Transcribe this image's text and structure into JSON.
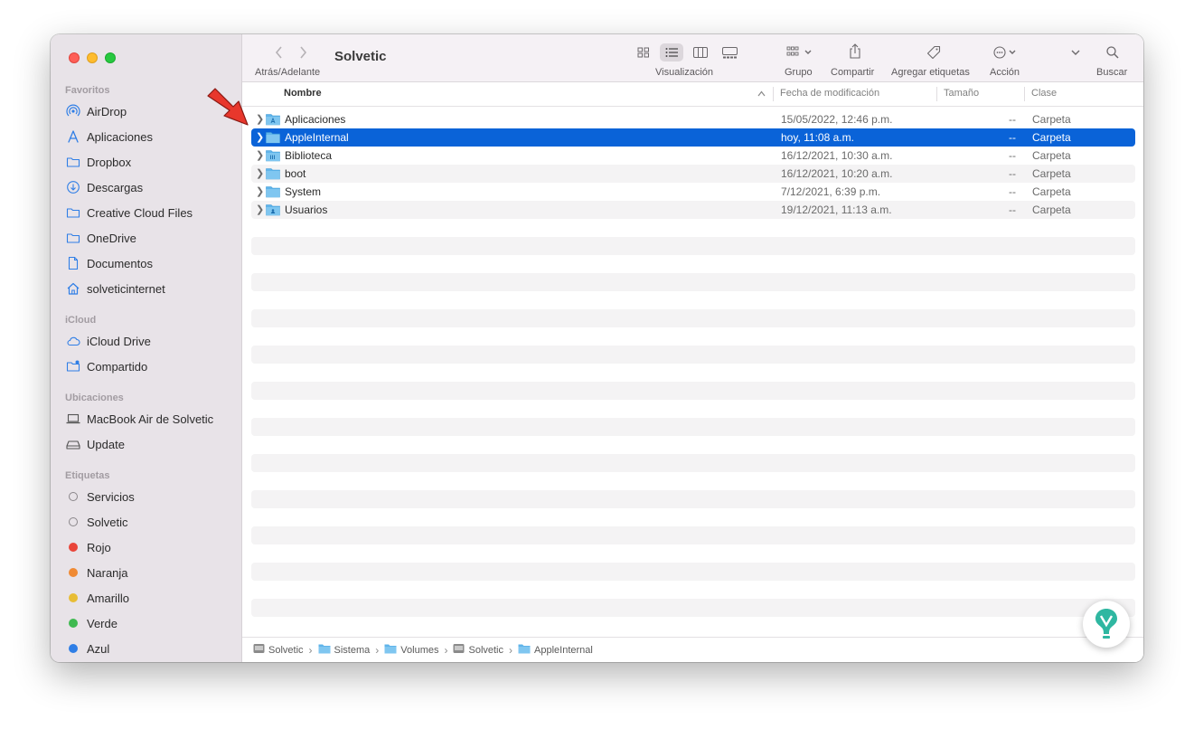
{
  "window": {
    "title": "Solvetic"
  },
  "toolbar": {
    "nav_label": "Atrás/Adelante",
    "view_label": "Visualización",
    "group_label": "Grupo",
    "share_label": "Compartir",
    "tags_label": "Agregar etiquetas",
    "action_label": "Acción",
    "search_label": "Buscar"
  },
  "sidebar": {
    "favorites_title": "Favoritos",
    "favorites": [
      {
        "label": "AirDrop",
        "icon": "airdrop-icon"
      },
      {
        "label": "Aplicaciones",
        "icon": "applications-icon"
      },
      {
        "label": "Dropbox",
        "icon": "folder-icon"
      },
      {
        "label": "Descargas",
        "icon": "download-icon"
      },
      {
        "label": "Creative Cloud Files",
        "icon": "folder-icon"
      },
      {
        "label": "OneDrive",
        "icon": "folder-icon"
      },
      {
        "label": "Documentos",
        "icon": "document-icon"
      },
      {
        "label": "solveticinternet",
        "icon": "home-icon"
      }
    ],
    "icloud_title": "iCloud",
    "icloud": [
      {
        "label": "iCloud Drive",
        "icon": "cloud-icon"
      },
      {
        "label": "Compartido",
        "icon": "shared-folder-icon"
      }
    ],
    "locations_title": "Ubicaciones",
    "locations": [
      {
        "label": "MacBook Air de Solvetic",
        "icon": "laptop-icon"
      },
      {
        "label": "Update",
        "icon": "disk-icon"
      }
    ],
    "tags_title": "Etiquetas",
    "tags": [
      {
        "label": "Servicios",
        "color": ""
      },
      {
        "label": "Solvetic",
        "color": ""
      },
      {
        "label": "Rojo",
        "color": "#e9453a"
      },
      {
        "label": "Naranja",
        "color": "#f08a34"
      },
      {
        "label": "Amarillo",
        "color": "#e8bd35"
      },
      {
        "label": "Verde",
        "color": "#3fb950"
      },
      {
        "label": "Azul",
        "color": "#2f7ee6"
      }
    ]
  },
  "columns": {
    "name": "Nombre",
    "date": "Fecha de modificación",
    "size": "Tamaño",
    "kind": "Clase"
  },
  "files": [
    {
      "name": "Aplicaciones",
      "date": "15/05/2022, 12:46 p.m.",
      "size": "--",
      "kind": "Carpeta",
      "icon": "applications-folder-icon",
      "selected": false
    },
    {
      "name": "AppleInternal",
      "date": "hoy, 11:08 a.m.",
      "size": "--",
      "kind": "Carpeta",
      "icon": "folder-icon",
      "selected": true
    },
    {
      "name": "Biblioteca",
      "date": "16/12/2021, 10:30 a.m.",
      "size": "--",
      "kind": "Carpeta",
      "icon": "library-folder-icon",
      "selected": false
    },
    {
      "name": "boot",
      "date": "16/12/2021, 10:20 a.m.",
      "size": "--",
      "kind": "Carpeta",
      "icon": "folder-icon",
      "selected": false
    },
    {
      "name": "System",
      "date": "7/12/2021, 6:39 p.m.",
      "size": "--",
      "kind": "Carpeta",
      "icon": "system-folder-icon",
      "selected": false
    },
    {
      "name": "Usuarios",
      "date": "19/12/2021, 11:13 a.m.",
      "size": "--",
      "kind": "Carpeta",
      "icon": "users-folder-icon",
      "selected": false
    }
  ],
  "pathbar": [
    {
      "label": "Solvetic",
      "icon": "disk-icon"
    },
    {
      "label": "Sistema",
      "icon": "folder-icon"
    },
    {
      "label": "Volumes",
      "icon": "folder-icon"
    },
    {
      "label": "Solvetic",
      "icon": "disk-icon"
    },
    {
      "label": "AppleInternal",
      "icon": "folder-icon"
    }
  ],
  "colors": {
    "selection": "#0a63d8",
    "folder": "#5fb4ea",
    "arrow": "#e8372c"
  }
}
